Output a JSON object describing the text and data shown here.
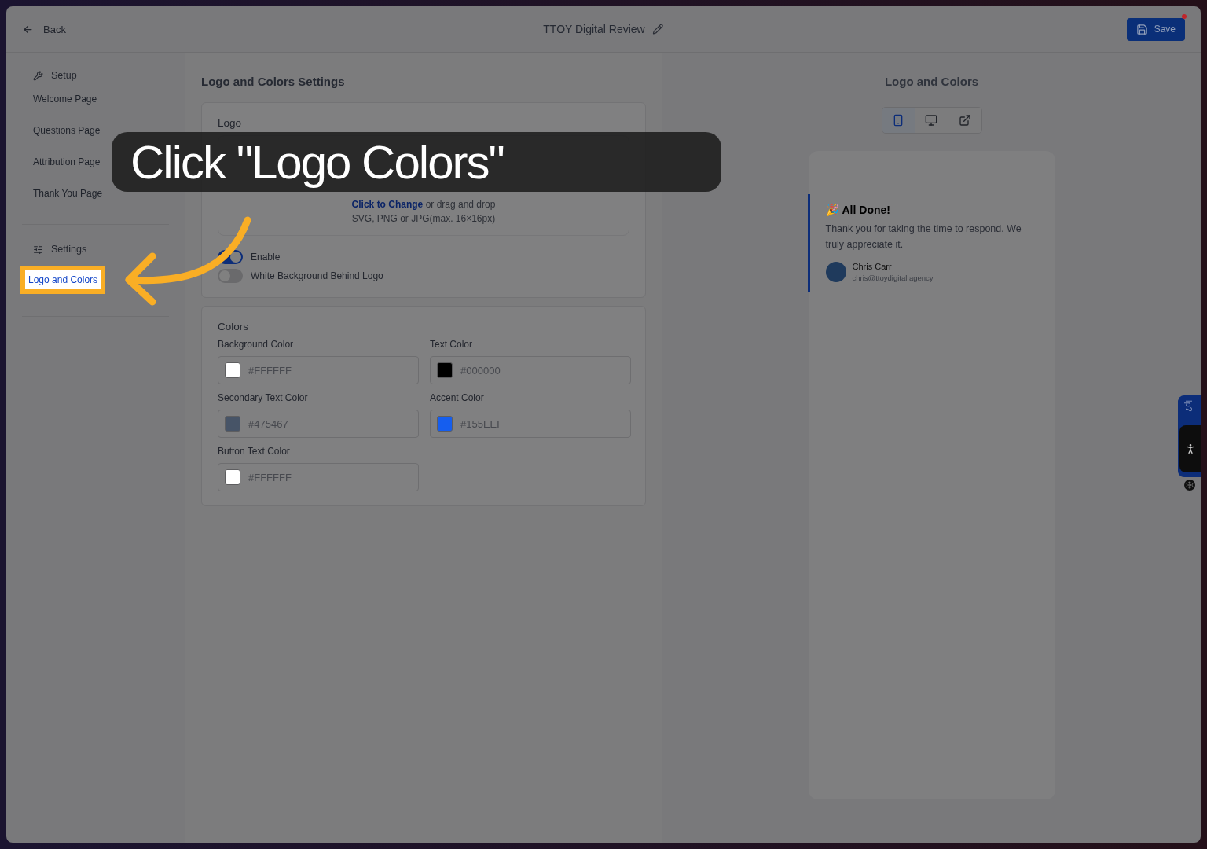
{
  "header": {
    "back_label": "Back",
    "title": "TTOY Digital Review",
    "save_label": "Save",
    "save_has_dot": true
  },
  "sidebar": {
    "groups": [
      {
        "heading": "Setup",
        "items": [
          {
            "label": "Welcome Page",
            "selected": false
          },
          {
            "label": "Questions Page",
            "selected": false
          },
          {
            "label": "Attribution Page",
            "selected": false
          },
          {
            "label": "Thank You Page",
            "selected": false
          }
        ]
      },
      {
        "heading": "Settings",
        "items": [
          {
            "label": "Logo and Colors",
            "selected": true
          }
        ]
      }
    ]
  },
  "settings": {
    "title": "Logo and Colors Settings",
    "logo": {
      "heading": "Logo",
      "upload_link": "Click to Change",
      "upload_text": "or drag and drop",
      "upload_hint": "SVG, PNG or JPG(max. 16×16px)",
      "toggles": [
        {
          "label": "Enable",
          "on": true
        },
        {
          "label": "White Background Behind Logo",
          "on": false
        }
      ]
    },
    "colors": {
      "heading": "Colors",
      "fields": [
        {
          "label": "Background Color",
          "value": "#FFFFFF",
          "color": "#ffffff"
        },
        {
          "label": "Text Color",
          "value": "#000000",
          "color": "#000000"
        },
        {
          "label": "Secondary Text Color",
          "value": "#475467",
          "color": "#475467"
        },
        {
          "label": "Accent Color",
          "value": "#155EEF",
          "color": "#155eef"
        },
        {
          "label": "Button Text Color",
          "value": "#FFFFFF",
          "color": "#ffffff"
        }
      ]
    }
  },
  "preview": {
    "title": "Logo and Colors",
    "devices": [
      {
        "kind": "mobile",
        "selected": true
      },
      {
        "kind": "desktop",
        "selected": false
      },
      {
        "kind": "external",
        "selected": false
      }
    ],
    "card": {
      "heading_icon": "🎉",
      "heading": "All Done!",
      "message": "Thank you for taking the time to respond. We truly appreciate it.",
      "author": "Chris Carr",
      "email": "chris@ttoydigital.agency"
    }
  },
  "help_tab": {
    "text": "lp?"
  },
  "tutorial": {
    "caption": "Click \"Logo Colors\""
  }
}
